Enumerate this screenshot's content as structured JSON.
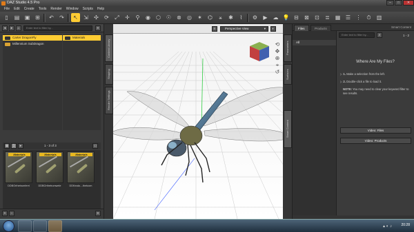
{
  "app": {
    "title": "DAZ Studio 4.5 Pro"
  },
  "menu": [
    "File",
    "Edit",
    "Create",
    "Tools",
    "Render",
    "Window",
    "Scripts",
    "Help"
  ],
  "content_library": {
    "search_placeholder": "Enter text to filter by...",
    "categories": [
      {
        "label": "Carter DragonFly",
        "selected": true
      },
      {
        "label": "Millennium SubDragon",
        "selected": false
      }
    ],
    "subfolders": [
      {
        "label": "Materials",
        "selected": true
      }
    ],
    "page_count": "1 - 3 of 3",
    "thumbnails": [
      {
        "badge": "Materials",
        "label": "DDBOrthetrumferri"
      },
      {
        "badge": "Materials",
        "label": "DDBOrthetrumwele"
      },
      {
        "badge": "Materials",
        "label": "DDKeala....thetcom"
      }
    ],
    "side_tabs": [
      "Content Library",
      "Shaping",
      "Render Settings"
    ]
  },
  "viewport": {
    "view_label": "Perspective View"
  },
  "smart_content": {
    "tabs": [
      "Files",
      "Products"
    ],
    "panel_tab": "Smart Content",
    "filter_items": [
      "All"
    ],
    "search_placeholder": "Enter text to filter by...",
    "page": "1 - 2",
    "heading": "Where Are My Files?",
    "steps": [
      "Make a selection from the left.",
      "Double-click a file to load it."
    ],
    "note_label": "NOTE:",
    "note_text": "You may need to clear your keyword filter to see results.",
    "buttons": [
      "Video: Files",
      "Video: Products"
    ]
  },
  "right_side_tabs": [
    "Parameters",
    "Surfaces",
    "Smart Content"
  ],
  "taskbar": {
    "time": "20:28"
  },
  "colors": {
    "accent": "#ffcc33",
    "panel": "#3b3b3b",
    "dark": "#2e2e2e"
  }
}
